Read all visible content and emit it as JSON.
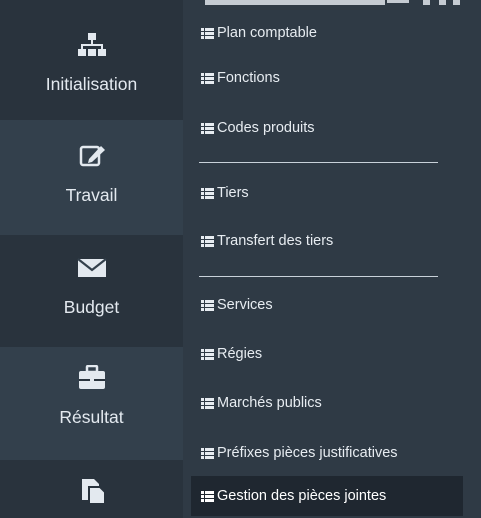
{
  "sidebar": {
    "items": [
      {
        "label": "Initialisation",
        "icon": "sitemap-icon"
      },
      {
        "label": "Travail",
        "icon": "edit-icon"
      },
      {
        "label": "Budget",
        "icon": "envelope-icon"
      },
      {
        "label": "Résultat",
        "icon": "briefcase-icon"
      },
      {
        "label": "",
        "icon": "documents-icon"
      }
    ]
  },
  "submenu": {
    "items": [
      {
        "label": "Plan comptable"
      },
      {
        "label": "Fonctions"
      },
      {
        "label": "Codes produits"
      },
      {
        "label": "Tiers"
      },
      {
        "label": "Transfert des tiers"
      },
      {
        "label": "Services"
      },
      {
        "label": "Régies"
      },
      {
        "label": "Marchés publics"
      },
      {
        "label": "Préfixes pièces justificatives"
      },
      {
        "label": "Gestion des pièces jointes",
        "active": true
      }
    ]
  },
  "colors": {
    "background": "#2f3a45",
    "sidebar_tile_dark": "#29333d",
    "sidebar_tile_light": "#33404c",
    "active_item_bg": "#1f2730",
    "text": "#e3e9ef"
  }
}
